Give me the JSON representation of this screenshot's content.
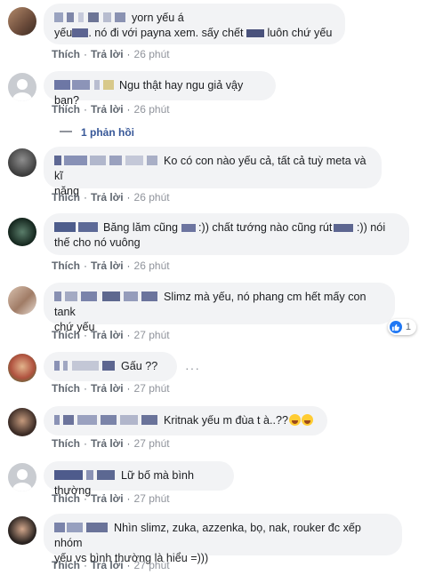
{
  "actions": {
    "like": "Thích",
    "reply": "Trả lời"
  },
  "comments": [
    {
      "text": "yorn yếu á yếu ... nó đi với payna xem. sấy chết ... luôn chứ yếu",
      "time": "26 phút"
    },
    {
      "text": "Ngu thật hay ngu giả vậy bạn?",
      "time": "26 phút"
    },
    {
      "text": "Ko có con nào yếu cả, tất cả tuỳ meta và kĩ năng",
      "time": "26 phút"
    },
    {
      "text": "Băng lăm cũng ... :)) chất tướng nào cũng rút ... :)) nói thế cho nó vuông",
      "time": "26 phút"
    },
    {
      "text": "Slimz mà yếu, nó phang cm hết mấy con tank chứ yếu",
      "time": "27 phút"
    },
    {
      "text": "Gấu ??",
      "time": "27 phút"
    },
    {
      "text": "Kritnak yếu m đùa t à..??",
      "time": "27 phút"
    },
    {
      "text": "Lữ bố mà bình thường",
      "time": "27 phút"
    },
    {
      "text": "Nhìn slimz, zuka, azzenka, bọ, nak, rouker đc xếp nhóm yếu vs bình thường là hiểu =)))",
      "time": "27 phút"
    }
  ],
  "c1": {
    "line1_a": "yorn yếu á",
    "line2_a": "yếu",
    "line2_b": ". nó đi với payna xem. sấy chết",
    "line2_c": "luôn chứ yếu"
  },
  "c2": {
    "text": "Ngu thật hay ngu giả vậy bạn?"
  },
  "replies_label": "1 phản hồi",
  "c3": {
    "line1": "Ko có con nào yếu cả, tất cả tuỳ meta và kĩ",
    "line2": "năng"
  },
  "c4": {
    "a": "Băng lăm cũng",
    "b": ":)) chất tướng nào cũng rút",
    "c": ":)) nói",
    "line2": "thế cho nó vuông"
  },
  "c5": {
    "line1": "Slimz mà yếu, nó phang cm hết mấy con tank",
    "line2": "chứ yếu"
  },
  "reaction_count": "1",
  "c6": {
    "text": "Gấu ??"
  },
  "more_label": "···",
  "c7": {
    "text": "Kritnak yếu m đùa t à..??"
  },
  "c8": {
    "text": "Lữ bố mà bình thường"
  },
  "c9": {
    "line1": "Nhìn slimz, zuka, azzenka, bọ, nak, rouker đc xếp nhóm",
    "line2": "yếu vs bình thường là hiểu =)))"
  },
  "colors": {
    "bubble": "#f2f3f5",
    "link": "#385898",
    "meta": "#606770",
    "time": "#90949c",
    "like": "#2078f4"
  }
}
